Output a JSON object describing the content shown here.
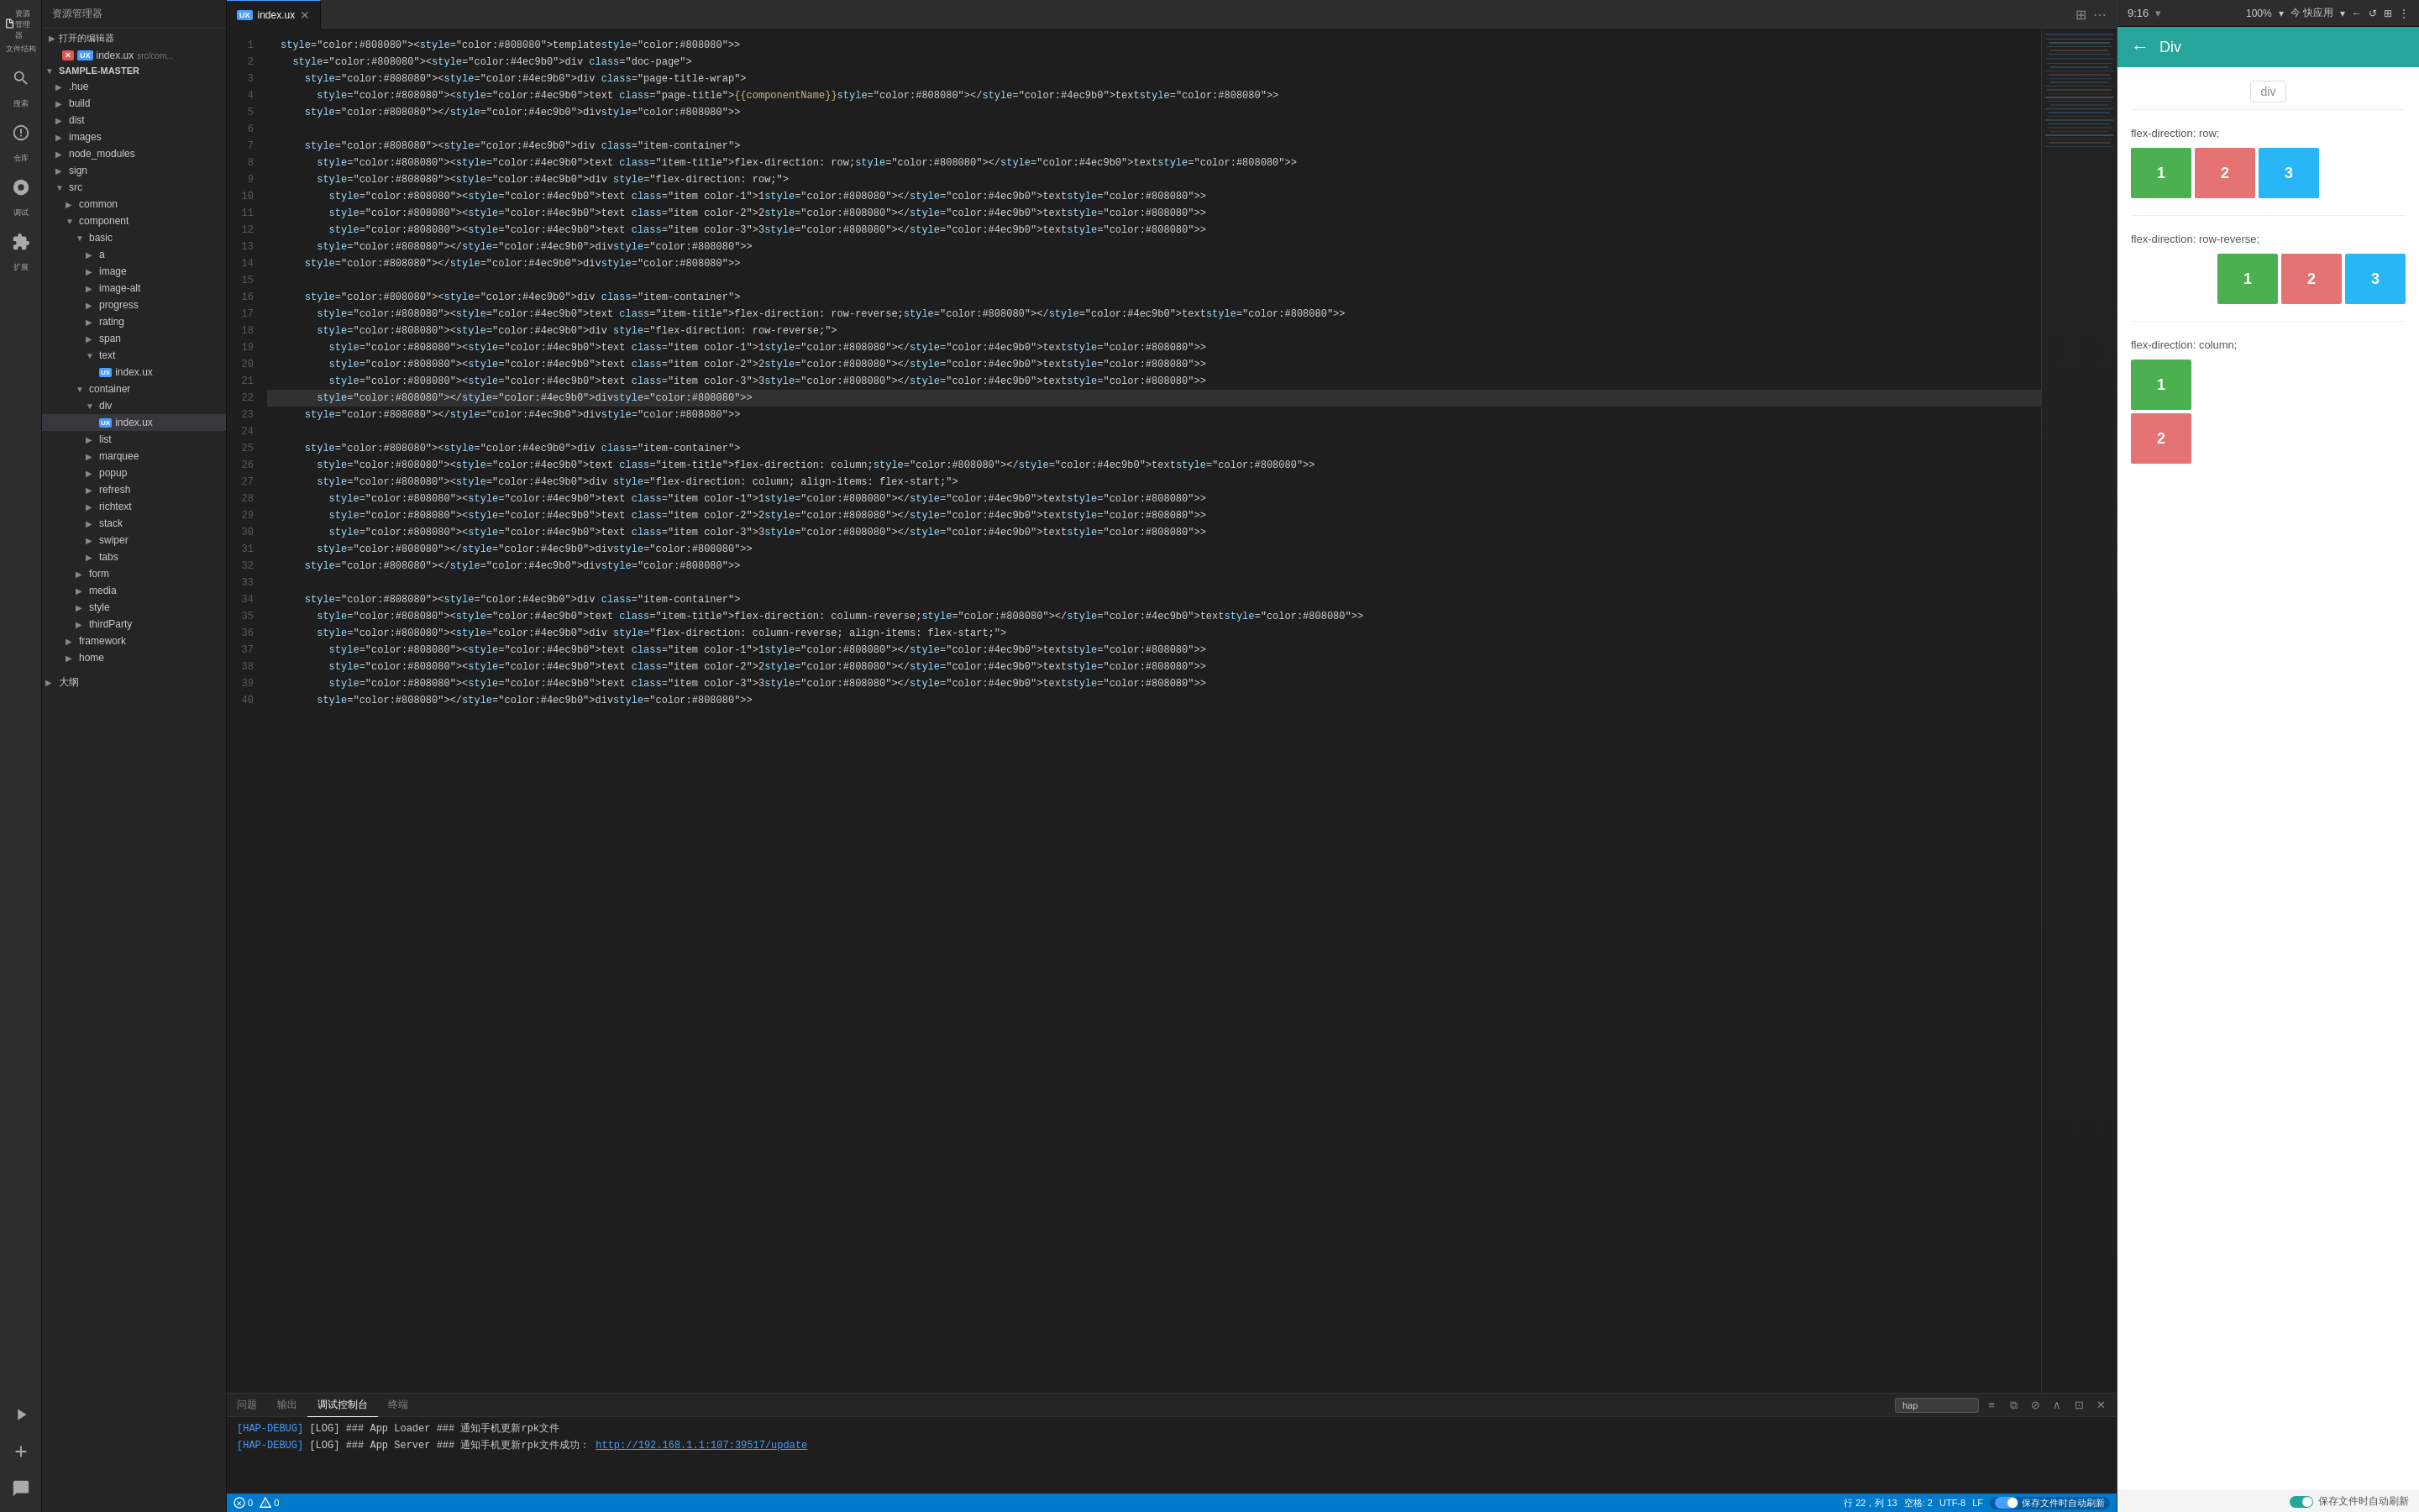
{
  "app": {
    "title": "资源管理器",
    "tab_label": "UX index.ux",
    "status_bar": {
      "errors": "0",
      "warnings": "0",
      "row": "行 22，列 13",
      "spaces": "空格: 2",
      "encoding": "UTF-8",
      "line_ending": "LF",
      "auto_save": "保存文件时自动刷新"
    }
  },
  "toolbar": {
    "time": "9:16",
    "zoom": "100%",
    "quick_apply": "今 快应用"
  },
  "sidebar": {
    "open_editors_label": "打开的编辑器",
    "open_file": {
      "badge": "UX",
      "name": "index.ux",
      "path": "src/com..."
    },
    "root": {
      "name": "SAMPLE-MASTER",
      "items": [
        {
          "name": ".hue",
          "type": "folder",
          "level": 1
        },
        {
          "name": "build",
          "type": "folder",
          "level": 1
        },
        {
          "name": "dist",
          "type": "folder",
          "level": 1
        },
        {
          "name": "images",
          "type": "folder",
          "level": 1
        },
        {
          "name": "node_modules",
          "type": "folder",
          "level": 1
        },
        {
          "name": "sign",
          "type": "folder",
          "level": 1
        },
        {
          "name": "src",
          "type": "folder",
          "level": 1,
          "expanded": true
        },
        {
          "name": "common",
          "type": "folder",
          "level": 2
        },
        {
          "name": "component",
          "type": "folder",
          "level": 2,
          "expanded": true
        },
        {
          "name": "basic",
          "type": "folder",
          "level": 3,
          "expanded": true
        },
        {
          "name": "a",
          "type": "folder",
          "level": 4
        },
        {
          "name": "image",
          "type": "folder",
          "level": 4
        },
        {
          "name": "image-alt",
          "type": "folder",
          "level": 4
        },
        {
          "name": "progress",
          "type": "folder",
          "level": 4
        },
        {
          "name": "rating",
          "type": "folder",
          "level": 4
        },
        {
          "name": "span",
          "type": "folder",
          "level": 4
        },
        {
          "name": "text",
          "type": "folder",
          "level": 4,
          "expanded": true
        },
        {
          "name": "index.ux",
          "type": "file",
          "level": 5,
          "badge": "UX"
        },
        {
          "name": "container",
          "type": "folder",
          "level": 3,
          "expanded": true
        },
        {
          "name": "div",
          "type": "folder",
          "level": 4,
          "expanded": true
        },
        {
          "name": "index.ux",
          "type": "file",
          "level": 5,
          "badge": "UX",
          "active": true
        },
        {
          "name": "list",
          "type": "folder",
          "level": 4
        },
        {
          "name": "marquee",
          "type": "folder",
          "level": 4
        },
        {
          "name": "popup",
          "type": "folder",
          "level": 4
        },
        {
          "name": "refresh",
          "type": "folder",
          "level": 4
        },
        {
          "name": "richtext",
          "type": "folder",
          "level": 4
        },
        {
          "name": "stack",
          "type": "folder",
          "level": 4
        },
        {
          "name": "swiper",
          "type": "folder",
          "level": 4
        },
        {
          "name": "tabs",
          "type": "folder",
          "level": 4
        },
        {
          "name": "form",
          "type": "folder",
          "level": 3
        },
        {
          "name": "media",
          "type": "folder",
          "level": 3
        },
        {
          "name": "style",
          "type": "folder",
          "level": 3
        },
        {
          "name": "thirdParty",
          "type": "folder",
          "level": 3
        },
        {
          "name": "framework",
          "type": "folder",
          "level": 2
        },
        {
          "name": "home",
          "type": "folder",
          "level": 2
        }
      ]
    },
    "outline": "大纲"
  },
  "editor": {
    "filename": "index.ux",
    "lines": [
      {
        "num": 1,
        "code": "<template>"
      },
      {
        "num": 2,
        "code": "  <div class=\"doc-page\">"
      },
      {
        "num": 3,
        "code": "    <div class=\"page-title-wrap\">"
      },
      {
        "num": 4,
        "code": "      <text class=\"page-title\">{{componentName}}</text>"
      },
      {
        "num": 5,
        "code": "    </div>"
      },
      {
        "num": 6,
        "code": ""
      },
      {
        "num": 7,
        "code": "    <div class=\"item-container\">"
      },
      {
        "num": 8,
        "code": "      <text class=\"item-title\">flex-direction: row;</text>"
      },
      {
        "num": 9,
        "code": "      <div style=\"flex-direction: row;\">"
      },
      {
        "num": 10,
        "code": "        <text class=\"item color-1\">1</text>"
      },
      {
        "num": 11,
        "code": "        <text class=\"item color-2\">2</text>"
      },
      {
        "num": 12,
        "code": "        <text class=\"item color-3\">3</text>"
      },
      {
        "num": 13,
        "code": "      </div>"
      },
      {
        "num": 14,
        "code": "    </div>"
      },
      {
        "num": 15,
        "code": ""
      },
      {
        "num": 16,
        "code": "    <div class=\"item-container\">"
      },
      {
        "num": 17,
        "code": "      <text class=\"item-title\">flex-direction: row-reverse;</text>"
      },
      {
        "num": 18,
        "code": "      <div style=\"flex-direction: row-reverse;\">"
      },
      {
        "num": 19,
        "code": "        <text class=\"item color-1\">1</text>"
      },
      {
        "num": 20,
        "code": "        <text class=\"item color-2\">2</text>"
      },
      {
        "num": 21,
        "code": "        <text class=\"item color-3\">3</text>"
      },
      {
        "num": 22,
        "code": "      </div>"
      },
      {
        "num": 23,
        "code": "    </div>"
      },
      {
        "num": 24,
        "code": ""
      },
      {
        "num": 25,
        "code": "    <div class=\"item-container\">"
      },
      {
        "num": 26,
        "code": "      <text class=\"item-title\">flex-direction: column;</text>"
      },
      {
        "num": 27,
        "code": "      <div style=\"flex-direction: column; align-items: flex-start;\">"
      },
      {
        "num": 28,
        "code": "        <text class=\"item color-1\">1</text>"
      },
      {
        "num": 29,
        "code": "        <text class=\"item color-2\">2</text>"
      },
      {
        "num": 30,
        "code": "        <text class=\"item color-3\">3</text>"
      },
      {
        "num": 31,
        "code": "      </div>"
      },
      {
        "num": 32,
        "code": "    </div>"
      },
      {
        "num": 33,
        "code": ""
      },
      {
        "num": 34,
        "code": "    <div class=\"item-container\">"
      },
      {
        "num": 35,
        "code": "      <text class=\"item-title\">flex-direction: column-reverse;</text>"
      },
      {
        "num": 36,
        "code": "      <div style=\"flex-direction: column-reverse; align-items: flex-start;\">"
      },
      {
        "num": 37,
        "code": "        <text class=\"item color-1\">1</text>"
      },
      {
        "num": 38,
        "code": "        <text class=\"item color-2\">2</text>"
      },
      {
        "num": 39,
        "code": "        <text class=\"item color-3\">3</text>"
      },
      {
        "num": 40,
        "code": "      </div>"
      }
    ]
  },
  "panel": {
    "tabs": [
      "问题",
      "输出",
      "调试控制台",
      "终端"
    ],
    "active_tab": "问题",
    "filter_placeholder": "hap",
    "debug_lines": [
      {
        "tag": "[HAP-DEBUG]",
        "msg": "[LOG] ### App Loader ### 通知手机更新rpk文件"
      },
      {
        "tag": "[HAP-DEBUG]",
        "msg": "[LOG] ### App Server ### 通知手机更新rpk文件成功：",
        "link": "http://192.168.1.1:107:39517/update"
      }
    ]
  },
  "preview": {
    "title": "Div",
    "back_icon": "←",
    "div_label": "div",
    "sections": [
      {
        "title": "flex-direction: row;",
        "type": "row",
        "items": [
          {
            "label": "1",
            "color": "#4caf50"
          },
          {
            "label": "2",
            "color": "#e57373"
          },
          {
            "label": "3",
            "color": "#29b6f6"
          }
        ]
      },
      {
        "title": "flex-direction: row-reverse;",
        "type": "row-reverse",
        "items": [
          {
            "label": "3",
            "color": "#29b6f6"
          },
          {
            "label": "2",
            "color": "#e57373"
          },
          {
            "label": "1",
            "color": "#4caf50"
          }
        ]
      },
      {
        "title": "flex-direction: column;",
        "type": "column",
        "items": [
          {
            "label": "1",
            "color": "#4caf50"
          },
          {
            "label": "2",
            "color": "#e57373"
          }
        ]
      }
    ],
    "auto_save_label": "保存文件时自动刷新"
  },
  "icons": {
    "file": "📄",
    "folder_closed": "▶",
    "folder_open": "▼",
    "search": "🔍",
    "git": "⑂",
    "debug": "🐞",
    "extension": "⬛",
    "run": "▶",
    "add": "+",
    "message": "✉",
    "layout": "⬜",
    "more": "⋯",
    "split": "⊞",
    "back": "←",
    "forward": "→",
    "refresh": "↺",
    "grid": "⊞",
    "up": "∧",
    "down": "∨",
    "close": "✕",
    "copy": "⧉",
    "clear": "⊘",
    "align": "≡",
    "terminal": "⊡"
  }
}
